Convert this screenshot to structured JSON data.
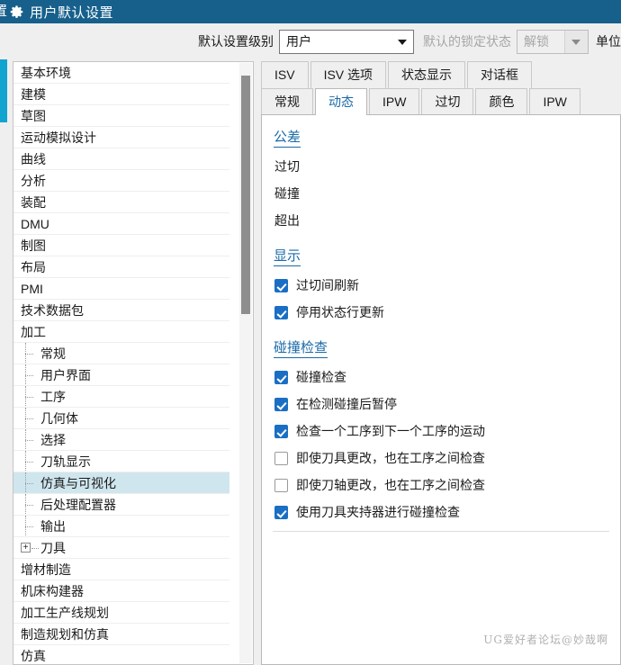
{
  "window": {
    "title": "用户默认设置",
    "title_cutoff": "置",
    "icon": "gear-icon"
  },
  "toolbar": {
    "level_label": "默认设置级别",
    "level_value": "用户",
    "lock_label": "默认的锁定状态",
    "lock_value": "解锁",
    "trailing_label": "单位"
  },
  "tree": {
    "items": [
      {
        "label": "基本环境",
        "level": 0,
        "selected": false,
        "expander": "none"
      },
      {
        "label": "建模",
        "level": 0,
        "selected": false,
        "expander": "none"
      },
      {
        "label": "草图",
        "level": 0,
        "selected": false,
        "expander": "none"
      },
      {
        "label": "运动模拟设计",
        "level": 0,
        "selected": false,
        "expander": "none"
      },
      {
        "label": "曲线",
        "level": 0,
        "selected": false,
        "expander": "none"
      },
      {
        "label": "分析",
        "level": 0,
        "selected": false,
        "expander": "none"
      },
      {
        "label": "装配",
        "level": 0,
        "selected": false,
        "expander": "none"
      },
      {
        "label": "DMU",
        "level": 0,
        "selected": false,
        "expander": "none"
      },
      {
        "label": "制图",
        "level": 0,
        "selected": false,
        "expander": "none"
      },
      {
        "label": "布局",
        "level": 0,
        "selected": false,
        "expander": "none"
      },
      {
        "label": "PMI",
        "level": 0,
        "selected": false,
        "expander": "none"
      },
      {
        "label": "技术数据包",
        "level": 0,
        "selected": false,
        "expander": "none"
      },
      {
        "label": "加工",
        "level": 0,
        "selected": false,
        "expander": "none"
      },
      {
        "label": "常规",
        "level": 1,
        "selected": false,
        "expander": "none"
      },
      {
        "label": "用户界面",
        "level": 1,
        "selected": false,
        "expander": "none"
      },
      {
        "label": "工序",
        "level": 1,
        "selected": false,
        "expander": "none"
      },
      {
        "label": "几何体",
        "level": 1,
        "selected": false,
        "expander": "none"
      },
      {
        "label": "选择",
        "level": 1,
        "selected": false,
        "expander": "none"
      },
      {
        "label": "刀轨显示",
        "level": 1,
        "selected": false,
        "expander": "none"
      },
      {
        "label": "仿真与可视化",
        "level": 1,
        "selected": true,
        "expander": "none"
      },
      {
        "label": "后处理配置器",
        "level": 1,
        "selected": false,
        "expander": "none"
      },
      {
        "label": "输出",
        "level": 1,
        "selected": false,
        "expander": "none"
      },
      {
        "label": "刀具",
        "level": 1,
        "selected": false,
        "expander": "plus"
      },
      {
        "label": "增材制造",
        "level": 0,
        "selected": false,
        "expander": "none"
      },
      {
        "label": "机床构建器",
        "level": 0,
        "selected": false,
        "expander": "none"
      },
      {
        "label": "加工生产线规划",
        "level": 0,
        "selected": false,
        "expander": "none"
      },
      {
        "label": "制造规划和仿真",
        "level": 0,
        "selected": false,
        "expander": "none"
      },
      {
        "label": "仿真",
        "level": 0,
        "selected": false,
        "expander": "none"
      }
    ]
  },
  "tabs_row1": [
    {
      "label": "ISV",
      "active": false
    },
    {
      "label": "ISV 选项",
      "active": false
    },
    {
      "label": "状态显示",
      "active": false
    },
    {
      "label": "对话框",
      "active": false
    }
  ],
  "tabs_row2": [
    {
      "label": "常规",
      "active": false
    },
    {
      "label": "动态",
      "active": true
    },
    {
      "label": "IPW",
      "active": false
    },
    {
      "label": "过切",
      "active": false
    },
    {
      "label": "颜色",
      "active": false
    },
    {
      "label": "IPW",
      "active": false
    }
  ],
  "panel": {
    "sections": [
      {
        "title": "公差",
        "kind": "fields",
        "rows": [
          {
            "label": "过切"
          },
          {
            "label": "碰撞"
          },
          {
            "label": "超出"
          }
        ]
      },
      {
        "title": "显示",
        "kind": "checks",
        "rows": [
          {
            "label": "过切间刷新",
            "checked": true
          },
          {
            "label": "停用状态行更新",
            "checked": true
          }
        ]
      },
      {
        "title": "碰撞检查",
        "kind": "checks",
        "rows": [
          {
            "label": "碰撞检查",
            "checked": true
          },
          {
            "label": "在检测碰撞后暂停",
            "checked": true
          },
          {
            "label": "检查一个工序到下一个工序的运动",
            "checked": true
          },
          {
            "label": "即使刀具更改，也在工序之间检查",
            "checked": false
          },
          {
            "label": "即使刀轴更改，也在工序之间检查",
            "checked": false
          },
          {
            "label": "使用刀具夹持器进行碰撞检查",
            "checked": true
          }
        ]
      }
    ]
  },
  "watermark": "UG爱好者论坛@妙哉啊",
  "colors": {
    "titlebar": "#17608c",
    "accent_strip": "#12a4d0",
    "section_heading": "#1a6aa8",
    "checkbox_on": "#1a6fc4",
    "tree_selected": "#cfe6ee"
  }
}
